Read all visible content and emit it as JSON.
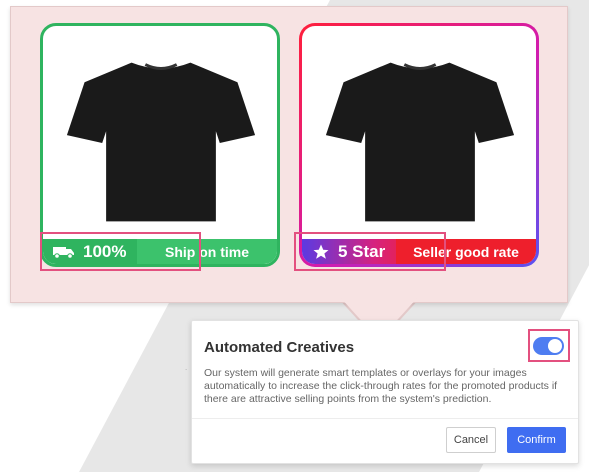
{
  "preview": {
    "card_left": {
      "badge_icon": "truck-icon",
      "badge_value": "100%",
      "badge_label": "Ship on time",
      "accent": "#2fb45f"
    },
    "card_right": {
      "badge_icon": "star-icon",
      "badge_value": "5 Star",
      "badge_label": "Seller good rate",
      "accent": "#ee1f2c"
    },
    "highlight_color": "#e3507f"
  },
  "dialog": {
    "title": "Automated Creatives",
    "description": "Our system will generate smart templates or overlays for your images automatically to increase the click-through rates for the promoted products if there are attractive selling points from the system's prediction.",
    "toggle_on": true,
    "cancel_label": "Cancel",
    "confirm_label": "Confirm",
    "accent": "#3f6df1"
  }
}
